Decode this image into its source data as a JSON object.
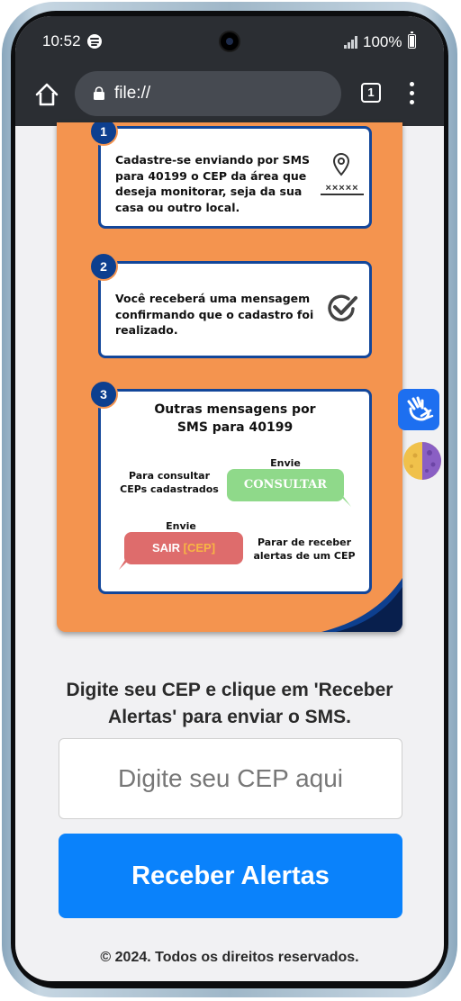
{
  "statusbar": {
    "time": "10:52",
    "battery": "100%"
  },
  "browser": {
    "address": "file://",
    "tab_count": "1"
  },
  "infographic": {
    "step1": {
      "number": "1",
      "text": [
        "Cadastre-se enviando por SMS",
        "para 40199 o CEP da área que",
        "deseja monitorar, seja da sua",
        "casa ou outro local."
      ],
      "placeholder_mark": "×××××"
    },
    "step2": {
      "number": "2",
      "text": [
        "Você receberá uma mensagem",
        "confirmando que o cadastro foi",
        "realizado."
      ]
    },
    "step3": {
      "number": "3",
      "title": [
        "Outras mensagens por",
        "SMS para 40199"
      ],
      "consult_label": [
        "Para consultar",
        "CEPs cadastrados"
      ],
      "send_label_1": "Envie",
      "consult_bubble": "CONSULTAR",
      "send_label_2": "Envie",
      "exit_bubble_word": "SAIR",
      "exit_bubble_cep": "[CEP]",
      "stop_label": [
        "Parar de receber",
        "alertas de um CEP"
      ]
    },
    "colors": {
      "orange": "#f4944f",
      "navy": "#12469a",
      "green": "#8fd98a",
      "red": "#de6c6c",
      "cep_highlight": "#f8b544"
    }
  },
  "side_tools": {
    "accessibility_icon": "sign-language-icon",
    "contrast_icon": "contrast-moon-icon"
  },
  "form": {
    "prompt_line1": "Digite seu CEP e clique em 'Receber",
    "prompt_line2": "Alertas' para enviar o SMS.",
    "cep_placeholder": "Digite seu CEP aqui",
    "submit_label": "Receber Alertas"
  },
  "footer": {
    "text": "© 2024. Todos os direitos reservados."
  }
}
